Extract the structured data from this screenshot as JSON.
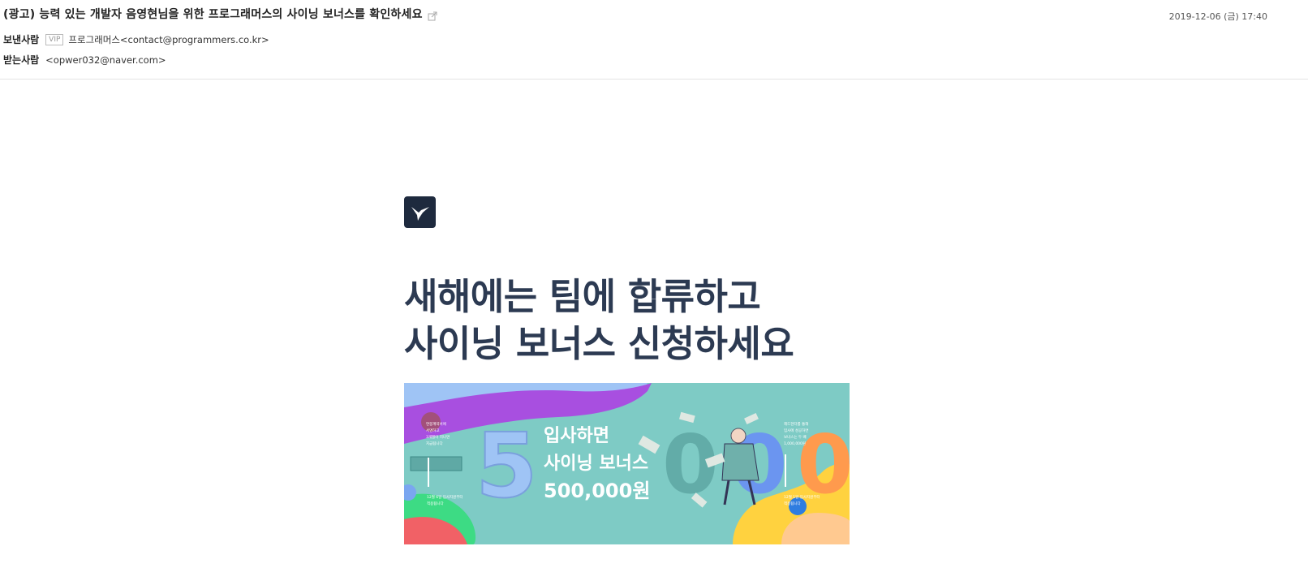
{
  "mail": {
    "subject": "(광고) 능력 있는 개발자 음영현님을 위한 프로그래머스의 사이닝 보너스를 확인하세요",
    "date": "2019-12-06 (금) 17:40",
    "from_label": "보낸사람",
    "vip_badge": "VIP",
    "from_address": "프로그래머스<contact@programmers.co.kr>",
    "to_label": "받는사람",
    "to_address": "<opwer032@naver.com>",
    "popout_icon": "external-window-icon"
  },
  "body": {
    "logo_icon": "hummingbird-logo-icon",
    "headline_line1": "새해에는 팀에 합류하고",
    "headline_line2": "사이닝 보너스 신청하세요",
    "banner": {
      "big_digit": "5",
      "line1": "입사하면",
      "line2": "사이닝 보너스",
      "line3": "500,000원",
      "zeros": [
        "0",
        "0",
        "0"
      ],
      "note_left": [
        "연봉계약서에",
        "서명하고",
        "3개월이 지나면",
        "지급됩니다"
      ],
      "note_left_bottom": [
        "12월 6일 입사지원부터",
        "적용됩니다"
      ],
      "note_right": [
        "헤드헌터를 통해",
        "입사에 성공하면",
        "보너스는 두 배",
        "1,000,000원"
      ],
      "note_right_bottom": [
        "12월 1일 입사지원부터",
        "적용됩니다"
      ],
      "colors": {
        "background": "#7ecbc5",
        "purple": "#a84fe0",
        "blue_light": "#9fc4f5",
        "red": "#f16166",
        "green": "#3ddb84",
        "yellow": "#ffd23f",
        "orange": "#ff9a4d",
        "peach": "#ffc990"
      }
    }
  }
}
